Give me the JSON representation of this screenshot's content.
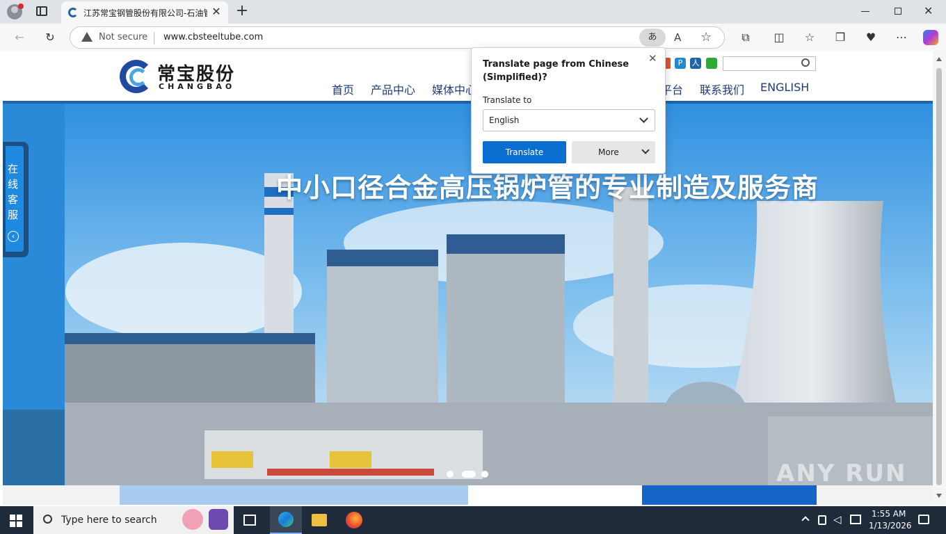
{
  "browser": {
    "tab_title": "江苏常宝钢管股份有限公司-石油管",
    "new_tab_symbol": "+",
    "security_label": "Not secure",
    "url": "www.cbsteeltube.com",
    "translate_indicator": "あ"
  },
  "site": {
    "logo_cn": "常宝股份",
    "logo_en": "CHANGBAO",
    "nav": [
      "首页",
      "产品中心",
      "媒体中心",
      "平台",
      "联系我们",
      "ENGLISH"
    ],
    "side_service": [
      "在",
      "线",
      "客",
      "服"
    ],
    "hero_slogan": "中小口径合金高压锅炉管的专业制造及服务商",
    "watermark": "ANY RUN"
  },
  "translate_popup": {
    "heading_line1": "Translate page from Chinese",
    "heading_line2": "(Simplified)?",
    "label": "Translate to",
    "selected_language": "English",
    "translate_button": "Translate",
    "more_button": "More"
  },
  "taskbar": {
    "search_placeholder": "Type here to search",
    "time": "1:55 AM",
    "date": "1/13/2026"
  },
  "colors": {
    "brand_blue": "#1f64a8",
    "edge_accent": "#0a6ed1"
  }
}
